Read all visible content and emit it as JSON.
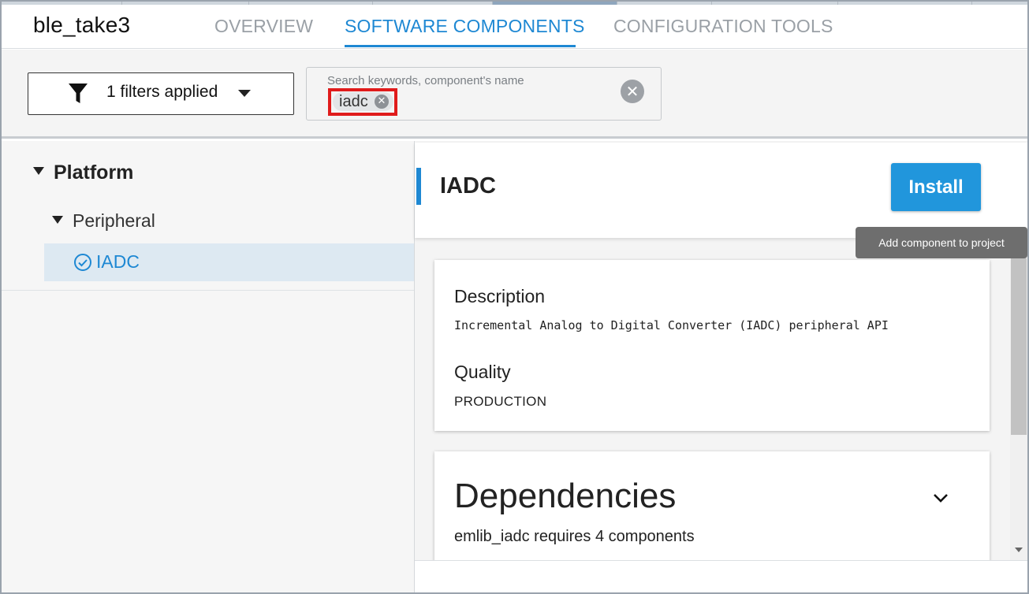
{
  "header": {
    "project_name": "ble_take3",
    "tabs": [
      {
        "label": "OVERVIEW",
        "active": false
      },
      {
        "label": "SOFTWARE COMPONENTS",
        "active": true
      },
      {
        "label": "CONFIGURATION TOOLS",
        "active": false
      }
    ]
  },
  "filter_bar": {
    "filter_button_label": "1 filters applied",
    "filter_icon": "funnel-icon",
    "search": {
      "placeholder": "Search keywords, component's name",
      "chips": [
        {
          "label": "iadc"
        }
      ],
      "clear_icon": "clear-circle-icon"
    }
  },
  "tree": {
    "items": [
      {
        "label": "Platform",
        "expanded": true,
        "level": 0
      },
      {
        "label": "Peripheral",
        "expanded": true,
        "level": 1
      },
      {
        "label": "IADC",
        "selected": true,
        "installed_icon": "check-circle-icon",
        "level": 2
      }
    ]
  },
  "component": {
    "title": "IADC",
    "install_label": "Install",
    "install_tooltip": "Add component to project",
    "description_label": "Description",
    "description": "Incremental Analog to Digital Converter (IADC) peripheral API",
    "quality_label": "Quality",
    "quality": "PRODUCTION",
    "dependencies_title": "Dependencies",
    "dependencies_summary": "emlib_iadc requires 4 components",
    "dependencies_icon": "chevron-down-icon"
  },
  "colors": {
    "accent": "#1e88d3",
    "install_button": "#2196dc",
    "highlight_box": "#e01b1b",
    "selected_row": "#dde9f2"
  }
}
